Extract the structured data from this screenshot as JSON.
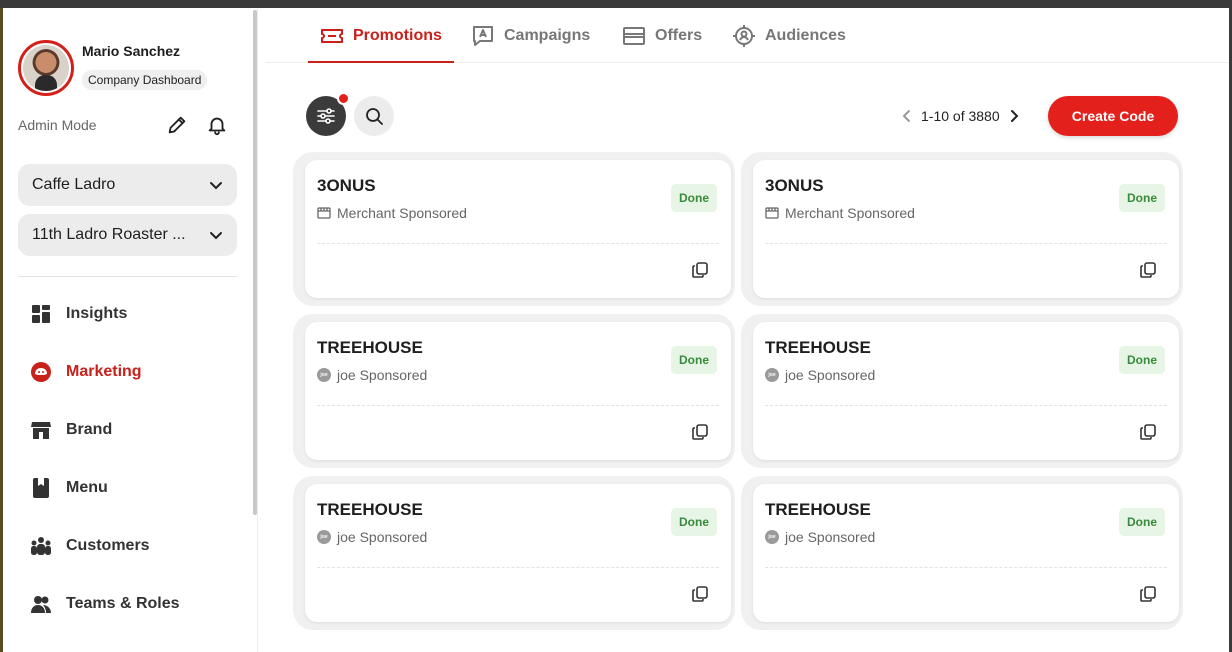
{
  "user": {
    "name": "Mario Sanchez",
    "role": "Company Dashboard",
    "mode": "Admin Mode"
  },
  "selectors": {
    "company": "Caffe Ladro",
    "location": "11th Ladro Roaster ..."
  },
  "nav": [
    {
      "label": "Insights",
      "icon": "grid-icon"
    },
    {
      "label": "Marketing",
      "icon": "marketing-icon",
      "active": true
    },
    {
      "label": "Brand",
      "icon": "storefront-icon"
    },
    {
      "label": "Menu",
      "icon": "book-icon"
    },
    {
      "label": "Customers",
      "icon": "people-icon"
    },
    {
      "label": "Teams & Roles",
      "icon": "team-icon"
    }
  ],
  "tabs": [
    {
      "label": "Promotions",
      "icon": "ticket-icon",
      "active": true
    },
    {
      "label": "Campaigns",
      "icon": "message-icon"
    },
    {
      "label": "Offers",
      "icon": "gift-icon"
    },
    {
      "label": "Audiences",
      "icon": "target-icon"
    }
  ],
  "pagination": {
    "text": "1-10 of 3880"
  },
  "actions": {
    "create": "Create Code"
  },
  "cards": [
    {
      "title": "3ONUS",
      "sponsor": "Merchant Sponsored",
      "sponsor_icon": "store-icon",
      "status": "Done"
    },
    {
      "title": "3ONUS",
      "sponsor": "Merchant Sponsored",
      "sponsor_icon": "store-icon",
      "status": "Done"
    },
    {
      "title": "TREEHOUSE",
      "sponsor": "joe Sponsored",
      "sponsor_icon": "joe-badge",
      "status": "Done"
    },
    {
      "title": "TREEHOUSE",
      "sponsor": "joe Sponsored",
      "sponsor_icon": "joe-badge",
      "status": "Done"
    },
    {
      "title": "TREEHOUSE",
      "sponsor": "joe Sponsored",
      "sponsor_icon": "joe-badge",
      "status": "Done"
    },
    {
      "title": "TREEHOUSE",
      "sponsor": "joe Sponsored",
      "sponsor_icon": "joe-badge",
      "status": "Done"
    }
  ],
  "joe_badge_text": "joe",
  "colors": {
    "accent": "#e3201b",
    "active_text": "#c8201b",
    "done_bg": "#e6f5e6",
    "done_text": "#3b8a3b"
  }
}
